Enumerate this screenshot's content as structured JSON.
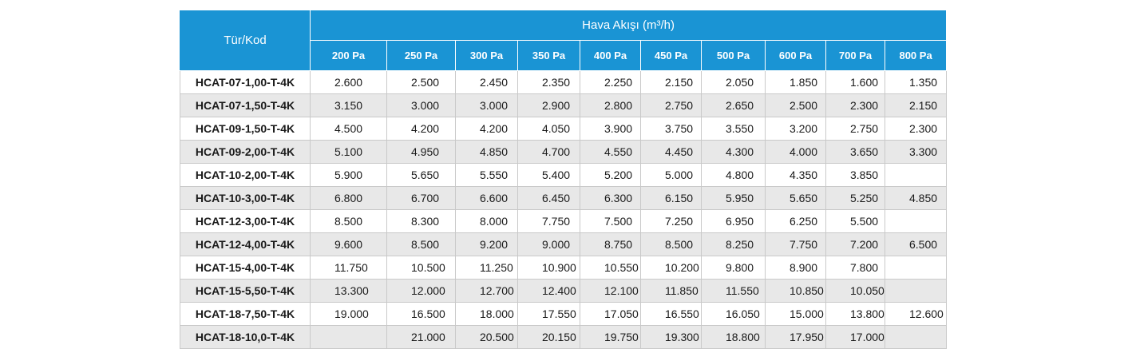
{
  "table": {
    "code_header": "Tür/Kod",
    "group_header": "Hava Akışı (m³/h)",
    "pressure_headers": [
      "200 Pa",
      "250 Pa",
      "300 Pa",
      "350 Pa",
      "400 Pa",
      "450 Pa",
      "500 Pa",
      "600 Pa",
      "700 Pa",
      "800 Pa"
    ],
    "rows": [
      {
        "code": "HCAT-07-1,00-T-4K",
        "values": [
          "2.600",
          "2.500",
          "2.450",
          "2.350",
          "2.250",
          "2.150",
          "2.050",
          "1.850",
          "1.600",
          "1.350"
        ]
      },
      {
        "code": "HCAT-07-1,50-T-4K",
        "values": [
          "3.150",
          "3.000",
          "3.000",
          "2.900",
          "2.800",
          "2.750",
          "2.650",
          "2.500",
          "2.300",
          "2.150"
        ]
      },
      {
        "code": "HCAT-09-1,50-T-4K",
        "values": [
          "4.500",
          "4.200",
          "4.200",
          "4.050",
          "3.900",
          "3.750",
          "3.550",
          "3.200",
          "2.750",
          "2.300"
        ]
      },
      {
        "code": "HCAT-09-2,00-T-4K",
        "values": [
          "5.100",
          "4.950",
          "4.850",
          "4.700",
          "4.550",
          "4.450",
          "4.300",
          "4.000",
          "3.650",
          "3.300"
        ]
      },
      {
        "code": "HCAT-10-2,00-T-4K",
        "values": [
          "5.900",
          "5.650",
          "5.550",
          "5.400",
          "5.200",
          "5.000",
          "4.800",
          "4.350",
          "3.850",
          ""
        ]
      },
      {
        "code": "HCAT-10-3,00-T-4K",
        "values": [
          "6.800",
          "6.700",
          "6.600",
          "6.450",
          "6.300",
          "6.150",
          "5.950",
          "5.650",
          "5.250",
          "4.850"
        ]
      },
      {
        "code": "HCAT-12-3,00-T-4K",
        "values": [
          "8.500",
          "8.300",
          "8.000",
          "7.750",
          "7.500",
          "7.250",
          "6.950",
          "6.250",
          "5.500",
          ""
        ]
      },
      {
        "code": "HCAT-12-4,00-T-4K",
        "values": [
          "9.600",
          "8.500",
          "9.200",
          "9.000",
          "8.750",
          "8.500",
          "8.250",
          "7.750",
          "7.200",
          "6.500"
        ]
      },
      {
        "code": "HCAT-15-4,00-T-4K",
        "values": [
          "11.750",
          "10.500",
          "11.250",
          "10.900",
          "10.550",
          "10.200",
          "9.800",
          "8.900",
          "7.800",
          ""
        ]
      },
      {
        "code": "HCAT-15-5,50-T-4K",
        "values": [
          "13.300",
          "12.000",
          "12.700",
          "12.400",
          "12.100",
          "11.850",
          "11.550",
          "10.850",
          "10.050",
          ""
        ]
      },
      {
        "code": "HCAT-18-7,50-T-4K",
        "values": [
          "19.000",
          "16.500",
          "18.000",
          "17.550",
          "17.050",
          "16.550",
          "16.050",
          "15.000",
          "13.800",
          "12.600"
        ]
      },
      {
        "code": "HCAT-18-10,0-T-4K",
        "values": [
          "",
          "21.000",
          "20.500",
          "20.150",
          "19.750",
          "19.300",
          "18.800",
          "17.950",
          "17.000",
          ""
        ]
      }
    ]
  },
  "colors": {
    "header_bg": "#1a94d4",
    "header_text": "#ffffff",
    "row_stripe": "#e8e8e8",
    "border": "#c9c9c9"
  }
}
